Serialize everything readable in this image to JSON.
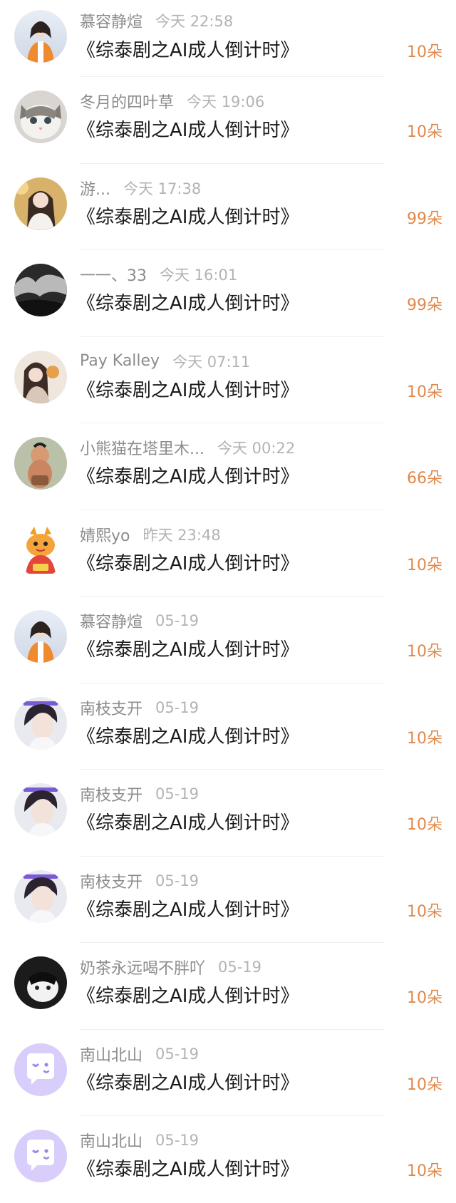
{
  "colors": {
    "username": "#8c8c8c",
    "time": "#b3b3b3",
    "title": "#1a1a1a",
    "gift": "#e0884a",
    "divider": "#f0f0f0"
  },
  "list": {
    "items": [
      {
        "username": "慕容静煊",
        "time": "今天 22:58",
        "title": "《综泰剧之AI成人倒计时》",
        "gift": "10朵",
        "avatar": "avatar-photo-girl-orange"
      },
      {
        "username": "冬月的四叶草",
        "time": "今天 19:06",
        "title": "《综泰剧之AI成人倒计时》",
        "gift": "10朵",
        "avatar": "avatar-photo-cat"
      },
      {
        "username": "游...",
        "time": "今天 17:38",
        "title": "《综泰剧之AI成人倒计时》",
        "gift": "99朵",
        "avatar": "avatar-photo-woman"
      },
      {
        "username": "一一、33",
        "time": "今天 16:01",
        "title": "《综泰剧之AI成人倒计时》",
        "gift": "99朵",
        "avatar": "avatar-photo-monochrome"
      },
      {
        "username": "Pay Kalley",
        "time": "今天 07:11",
        "title": "《综泰剧之AI成人倒计时》",
        "gift": "10朵",
        "avatar": "avatar-photo-girl"
      },
      {
        "username": "小熊猫在塔里木...",
        "time": "今天 00:22",
        "title": "《综泰剧之AI成人倒计时》",
        "gift": "66朵",
        "avatar": "avatar-photo-baby"
      },
      {
        "username": "婧熙yo",
        "time": "昨天 23:48",
        "title": "《综泰剧之AI成人倒计时》",
        "gift": "10朵",
        "avatar": "avatar-cartoon-dragon"
      },
      {
        "username": "慕容静煊",
        "time": "05-19",
        "title": "《综泰剧之AI成人倒计时》",
        "gift": "10朵",
        "avatar": "avatar-photo-girl-orange"
      },
      {
        "username": "南枝支开",
        "time": "05-19",
        "title": "《综泰剧之AI成人倒计时》",
        "gift": "10朵",
        "avatar": "avatar-photo-man"
      },
      {
        "username": "南枝支开",
        "time": "05-19",
        "title": "《综泰剧之AI成人倒计时》",
        "gift": "10朵",
        "avatar": "avatar-photo-man"
      },
      {
        "username": "南枝支开",
        "time": "05-19",
        "title": "《综泰剧之AI成人倒计时》",
        "gift": "10朵",
        "avatar": "avatar-photo-man"
      },
      {
        "username": "奶茶永远喝不胖吖",
        "time": "05-19",
        "title": "《综泰剧之AI成人倒计时》",
        "gift": "10朵",
        "avatar": "avatar-photo-black-cat"
      },
      {
        "username": "南山北山",
        "time": "05-19",
        "title": "《综泰剧之AI成人倒计时》",
        "gift": "10朵",
        "avatar": "avatar-default-chat"
      },
      {
        "username": "南山北山",
        "time": "05-19",
        "title": "《综泰剧之AI成人倒计时》",
        "gift": "10朵",
        "avatar": "avatar-default-chat"
      }
    ]
  }
}
